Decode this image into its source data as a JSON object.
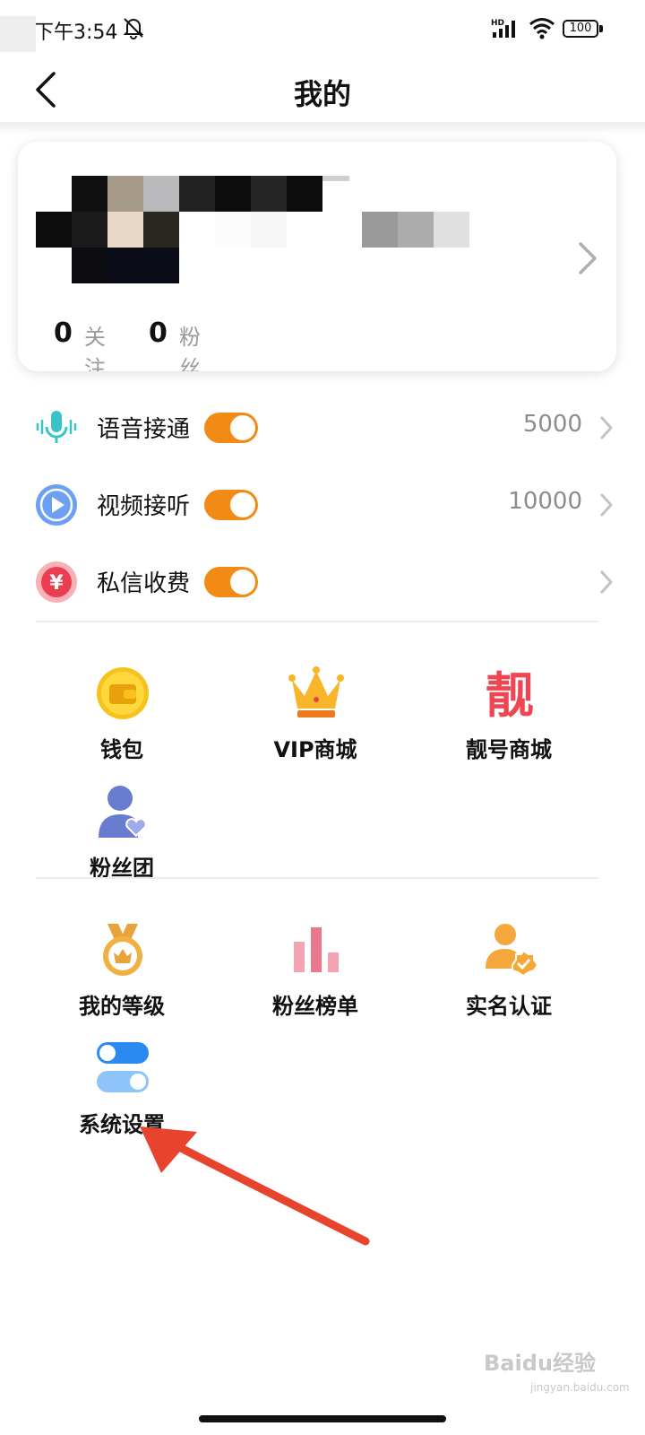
{
  "status_bar": {
    "time": "下午3:54",
    "network": "HD",
    "battery": "100"
  },
  "header": {
    "title": "我的"
  },
  "profile": {
    "following_count": "0",
    "following_label": "关注",
    "fans_count": "0",
    "fans_label": "粉丝"
  },
  "settings_rows": [
    {
      "label": "语音接通",
      "value": "5000",
      "enabled": true,
      "icon": "microphone-icon"
    },
    {
      "label": "视频接听",
      "value": "10000",
      "enabled": true,
      "icon": "play-icon"
    },
    {
      "label": "私信收费",
      "value": "",
      "enabled": true,
      "icon": "yen-icon"
    }
  ],
  "grid_section_1": [
    {
      "label": "钱包",
      "icon": "wallet-icon"
    },
    {
      "label": "VIP商城",
      "icon": "crown-icon"
    },
    {
      "label": "靓号商城",
      "icon": "liang-character-icon",
      "icon_text": "靓"
    },
    {
      "label": "粉丝团",
      "icon": "fan-group-icon"
    }
  ],
  "grid_section_2": [
    {
      "label": "我的等级",
      "icon": "medal-icon"
    },
    {
      "label": "粉丝榜单",
      "icon": "bar-ranking-icon"
    },
    {
      "label": "实名认证",
      "icon": "verified-user-icon"
    },
    {
      "label": "系统设置",
      "icon": "toggle-settings-icon"
    }
  ],
  "watermark": {
    "text": "Baidu经验",
    "sub": "jingyan.baidu.com"
  },
  "colors": {
    "toggle_on": "#f28a16",
    "annotation_arrow": "#e8432c",
    "muted_text": "#9a9a9a"
  }
}
